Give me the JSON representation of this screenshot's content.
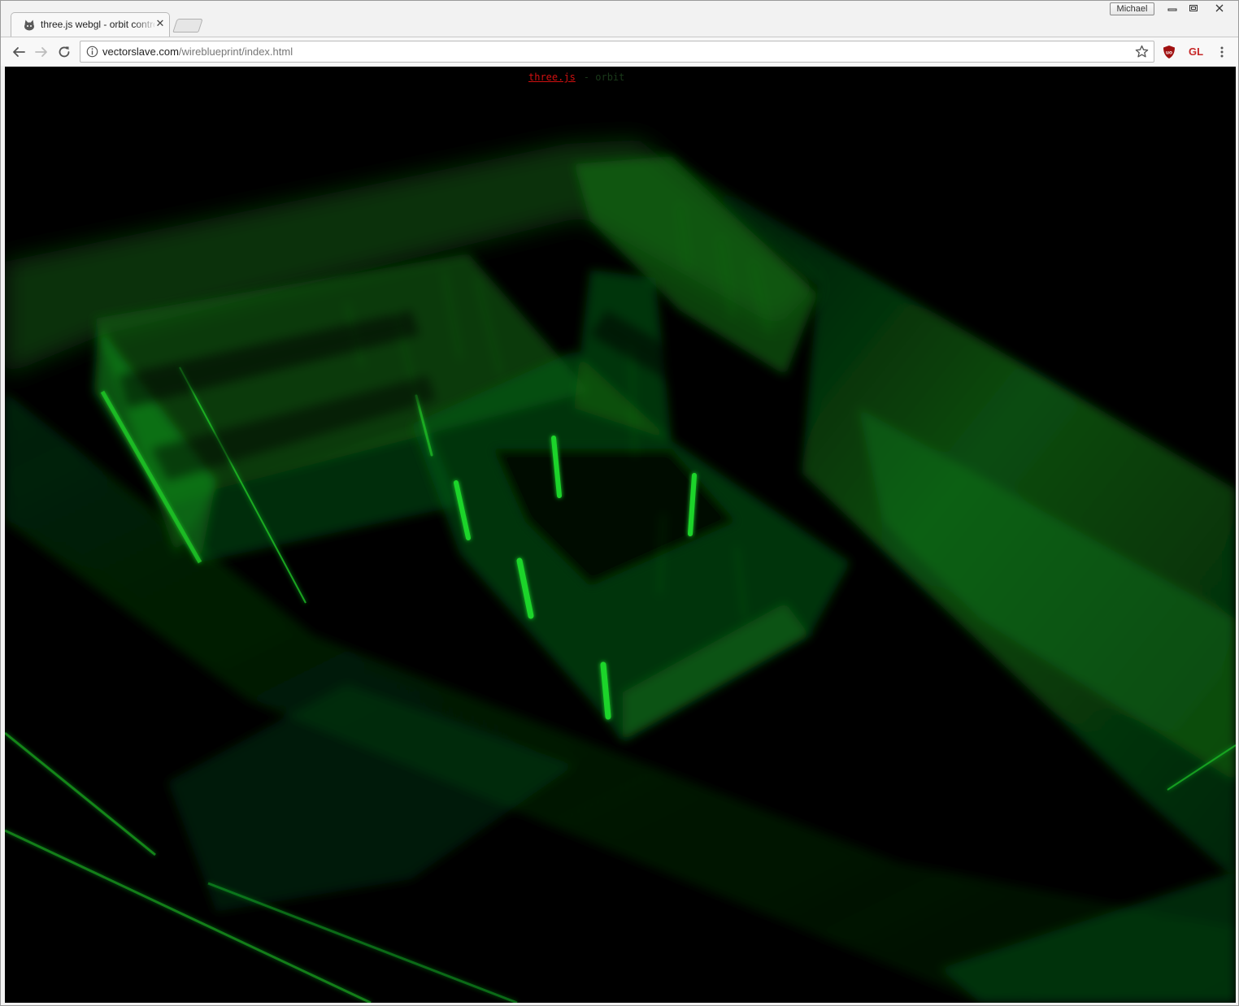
{
  "window": {
    "profile_name": "Michael"
  },
  "tabs": [
    {
      "title": "three.js webgl - orbit controls",
      "active": true
    }
  ],
  "toolbar": {
    "url_host": "vectorslave.com",
    "url_path": "/wireblueprint/index.html",
    "extension_gl_label": "GL"
  },
  "content": {
    "info_link": "three.js",
    "info_rest": "- orbit"
  },
  "colors": {
    "scene_background": "#000000",
    "wire_green": "#1fd42a",
    "info_link": "#d01010",
    "ublock_red": "#a01010"
  },
  "icons": {
    "back": "back-arrow-icon",
    "forward": "forward-arrow-icon",
    "reload": "reload-icon",
    "info": "info-icon",
    "bookmark": "star-icon",
    "ublock": "ublock-shield-icon",
    "menu": "kebab-menu-icon",
    "favicon": "threejs-favicon-icon"
  }
}
